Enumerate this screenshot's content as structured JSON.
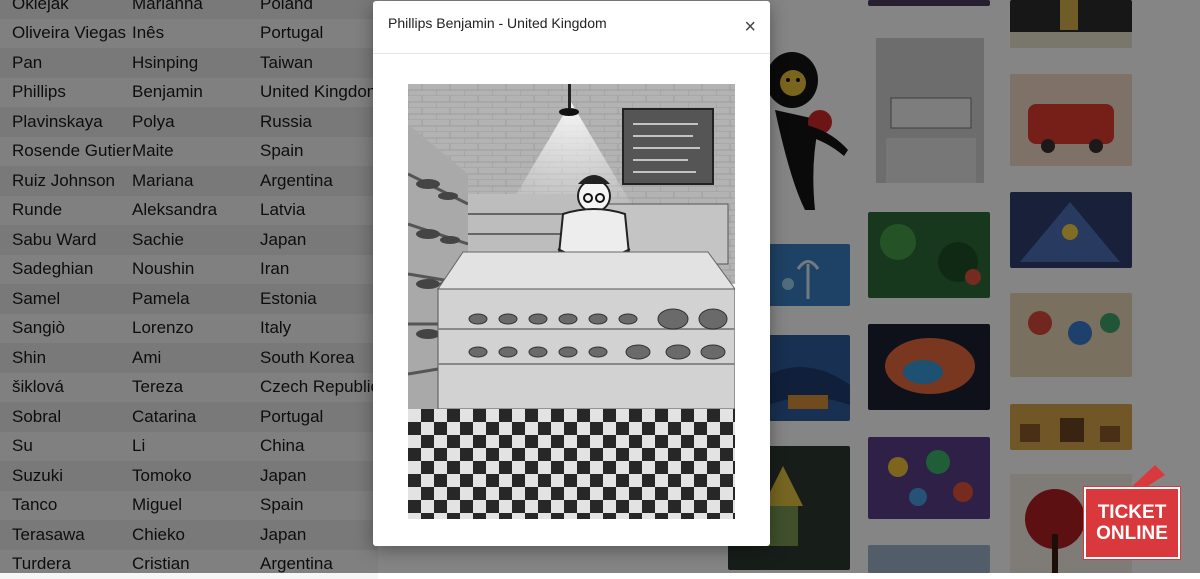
{
  "artists": [
    {
      "last": "Oklejak",
      "first": "Marianna",
      "country": "Poland"
    },
    {
      "last": "Oliveira Viegas",
      "first": "Inês",
      "country": "Portugal"
    },
    {
      "last": "Pan",
      "first": "Hsinping",
      "country": "Taiwan"
    },
    {
      "last": "Phillips",
      "first": "Benjamin",
      "country": "United Kingdom"
    },
    {
      "last": "Plavinskaya",
      "first": "Polya",
      "country": "Russia"
    },
    {
      "last": "Rosende Gutierrez",
      "first": "Maite",
      "country": "Spain"
    },
    {
      "last": "Ruiz Johnson",
      "first": "Mariana",
      "country": "Argentina"
    },
    {
      "last": "Runde",
      "first": "Aleksandra",
      "country": "Latvia"
    },
    {
      "last": "Sabu Ward",
      "first": "Sachie",
      "country": "Japan"
    },
    {
      "last": "Sadeghian",
      "first": "Noushin",
      "country": "Iran"
    },
    {
      "last": "Samel",
      "first": "Pamela",
      "country": "Estonia"
    },
    {
      "last": "Sangiò",
      "first": "Lorenzo",
      "country": "Italy"
    },
    {
      "last": "Shin",
      "first": "Ami",
      "country": "South Korea"
    },
    {
      "last": "šiklová",
      "first": "Tereza",
      "country": "Czech Republic"
    },
    {
      "last": "Sobral",
      "first": "Catarina",
      "country": "Portugal"
    },
    {
      "last": "Su",
      "first": "Li",
      "country": "China"
    },
    {
      "last": "Suzuki",
      "first": "Tomoko",
      "country": "Japan"
    },
    {
      "last": "Tanco",
      "first": "Miguel",
      "country": "Spain"
    },
    {
      "last": "Terasawa",
      "first": "Chieko",
      "country": "Japan"
    },
    {
      "last": "Turdera",
      "first": "Cristian",
      "country": "Argentina"
    }
  ],
  "modal": {
    "title": "Phillips Benjamin - United Kingdom",
    "close_label": "×"
  },
  "ticket": {
    "line1": "TICKET",
    "line2": "ONLINE"
  },
  "colors": {
    "ticket": "#d9393c",
    "overlay": "rgba(0,0,0,0.48)"
  }
}
